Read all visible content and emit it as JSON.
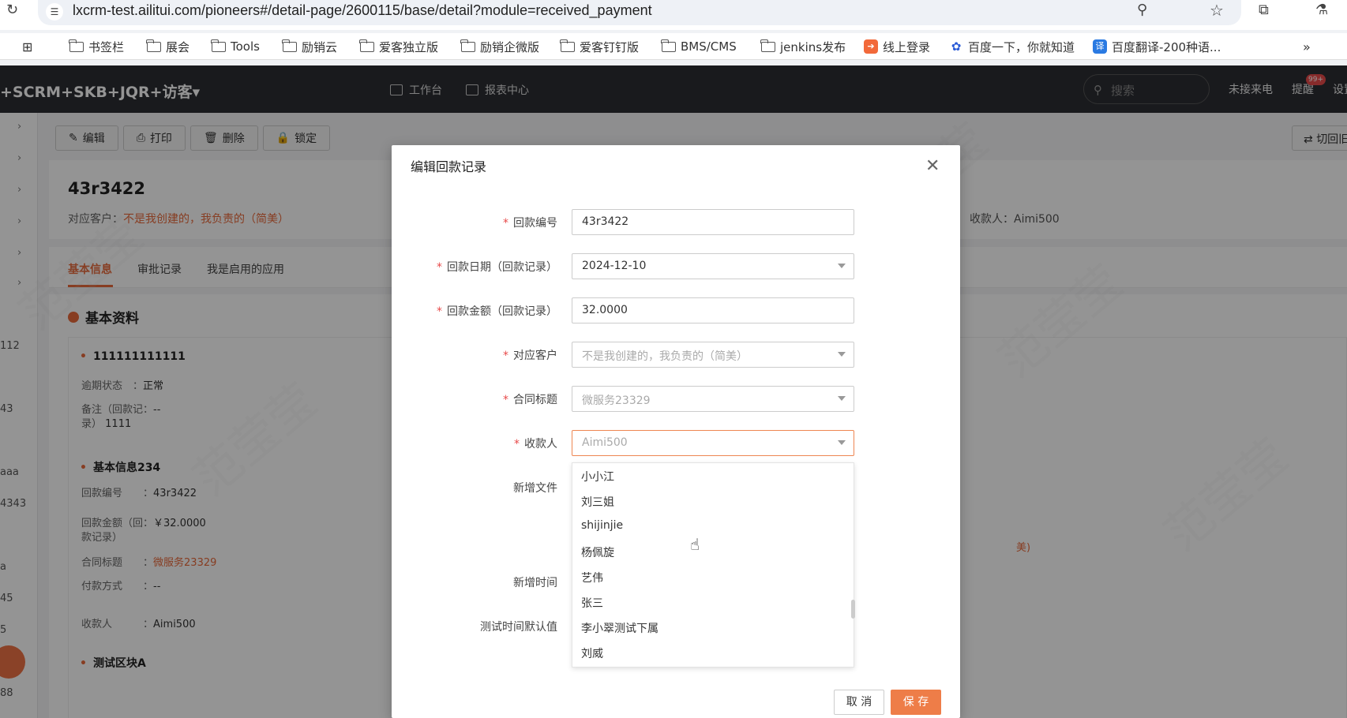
{
  "browser": {
    "url": "lxcrm-test.ailitui.com/pioneers#/detail-page/2600115/base/detail?module=received_payment",
    "bookmarks": [
      "书签栏",
      "展会",
      "Tools",
      "励销云",
      "爱客独立版",
      "励销企微版",
      "爱客钉钉版",
      "BMS/CMS",
      "jenkins发布",
      "线上登录",
      "百度一下，你就知道",
      "百度翻译-200种语..."
    ]
  },
  "app": {
    "title": "+SCRM+SKB+JQR+访客▾",
    "nav": [
      "工作台",
      "报表中心"
    ],
    "search_placeholder": "搜索",
    "missed_calls": "未接来电",
    "reminder": "提醒",
    "reminder_badge": "99+",
    "settings": "设置"
  },
  "page": {
    "toolbar": [
      "编辑",
      "打印",
      "删除",
      "锁定"
    ],
    "switch_label": "切回旧",
    "record_title": "43r3422",
    "customer_label": "对应客户：",
    "customer_value": "不是我创建的，我负责的（简美）",
    "payee_text": "收款人：Aimi500",
    "tabs": [
      "基本信息",
      "审批记录",
      "我是启用的应用"
    ],
    "section_title": "基本资料",
    "group1": "111111111111",
    "overdue_label": "逾期状态",
    "overdue_value": "正常",
    "remark_label": "备注（回款记：",
    "remark_label2": "录）",
    "remark_value": "--",
    "remark_value2": "1111",
    "group2": "基本信息234",
    "num_label": "回款编号",
    "num_value": "43r3422",
    "amount_label": "回款金额（回：",
    "amount_label2": "款记录）",
    "amount_value": "￥32.0000",
    "contract_label": "合同标题",
    "contract_value": "微服务23329",
    "paymethod_label": "付款方式",
    "paymethod_value": "--",
    "payee_label": "收款人",
    "payee_value": "Aimi500",
    "group3": "测试区块A",
    "partial_link": "美)",
    "rail_numbers": [
      "112",
      "43",
      "aaa",
      "4343",
      "a",
      "45",
      "5",
      "88"
    ]
  },
  "modal": {
    "title": "编辑回款记录",
    "fields": [
      {
        "label": "回款编号",
        "value": "43r3422",
        "required": true
      },
      {
        "label": "回款日期（回款记录）",
        "value": "2024-12-10",
        "required": true
      },
      {
        "label": "回款金额（回款记录）",
        "value": "32.0000",
        "required": true
      },
      {
        "label": "对应客户",
        "value": "不是我创建的，我负责的（简美）",
        "required": true
      },
      {
        "label": "合同标题",
        "value": "微服务23329",
        "required": true
      },
      {
        "label": "收款人",
        "value": "Aimi500",
        "required": true
      }
    ],
    "other_labels": [
      "新增文件",
      "新增时间",
      "测试时间默认值"
    ],
    "dropdown_options": [
      "小小江",
      "刘三姐",
      "shijinjie",
      "杨佩旋",
      "艺伟",
      "张三",
      "李小翠测试下属",
      "刘威"
    ],
    "cancel": "取 消",
    "save": "保 存"
  },
  "watermark": "范莹莹"
}
